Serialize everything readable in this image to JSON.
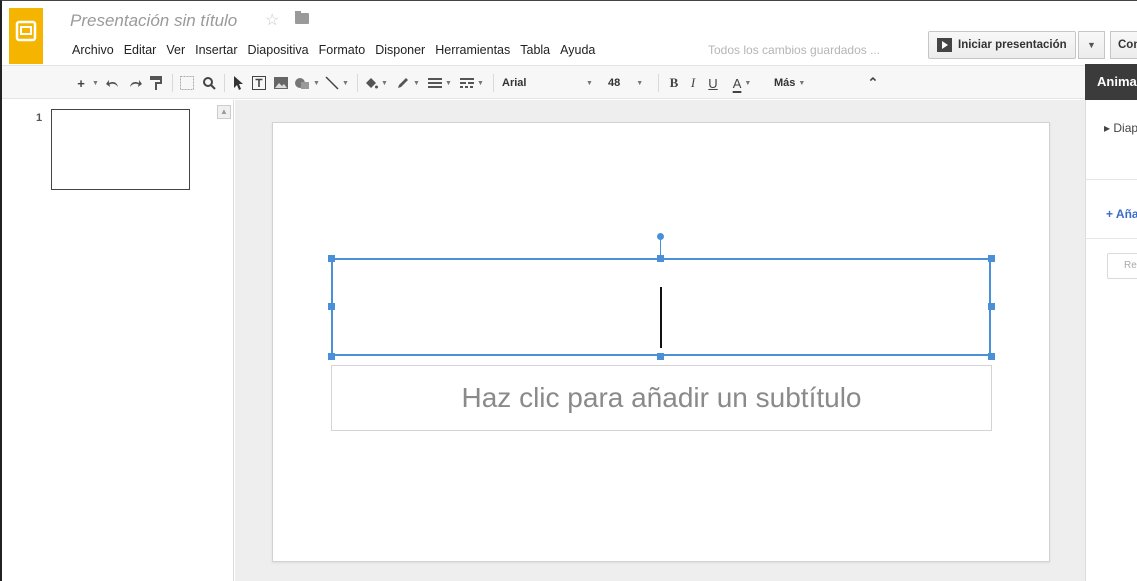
{
  "header": {
    "doc_title": "Presentación sin título",
    "star_icon": "☆",
    "save_status": "Todos los cambios guardados ...",
    "present_label": "Iniciar presentación",
    "present_dropdown": "▼",
    "share_label": "Compartir"
  },
  "menu": [
    "Archivo",
    "Editar",
    "Ver",
    "Insertar",
    "Diapositiva",
    "Formato",
    "Disponer",
    "Herramientas",
    "Tabla",
    "Ayuda"
  ],
  "toolbar": {
    "font_name": "Arial",
    "font_size": "48",
    "bold": "B",
    "italic": "I",
    "underline": "U",
    "text_color": "A",
    "more": "Más",
    "collapse": "⌃"
  },
  "filmstrip": {
    "slide_number": "1"
  },
  "slide": {
    "subtitle_placeholder": "Haz clic para añadir un subtítulo"
  },
  "right_panel": {
    "header": "Animaciones",
    "slide_label": "▸ Diapositiva",
    "add_label": "+ Añadir animación",
    "button_label": "Reproducir"
  },
  "colors": {
    "logo": "#f4b400",
    "selection": "#4a90d9",
    "panel_header": "#3b3b3b",
    "link": "#3b6cc7"
  }
}
